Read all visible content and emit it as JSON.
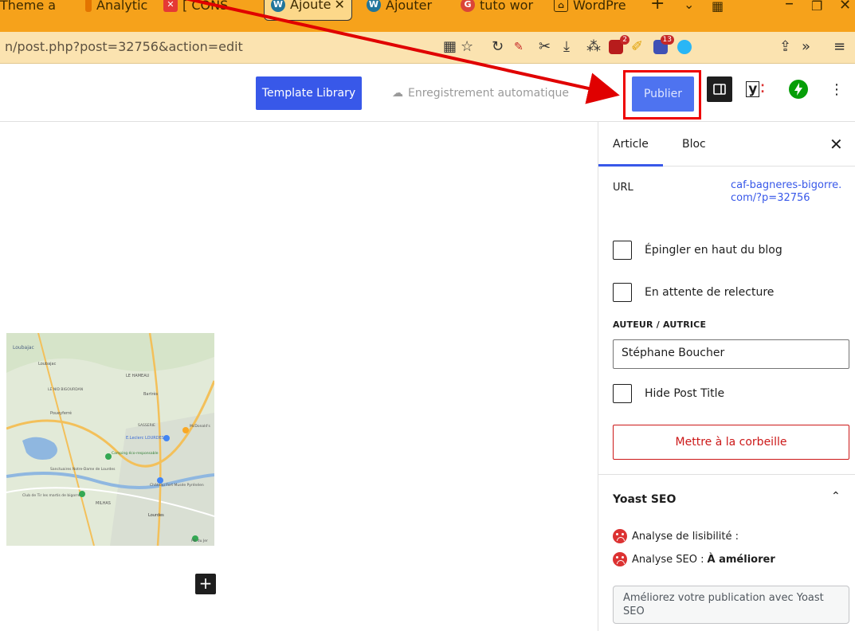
{
  "browser": {
    "tabs": [
      {
        "label": "Theme a",
        "icon": "theme-tab-icon"
      },
      {
        "label": "Analytic",
        "icon": "analytics-tab-icon"
      },
      {
        "label": "[ CONS",
        "icon": "cons-tab-icon"
      },
      {
        "label": "Ajoute",
        "icon": "wordpress-tab-icon"
      },
      {
        "label": "Ajouter",
        "icon": "wordpress-tab-icon"
      },
      {
        "label": "tuto wor",
        "icon": "google-tab-icon"
      },
      {
        "label": "WordPre",
        "icon": "wordpress-tab-icon"
      }
    ],
    "url": "n/post.php?post=32756&action=edit",
    "extension_badges": {
      "badge_a": "2",
      "badge_b": "13"
    }
  },
  "header": {
    "template_button": "Template Library",
    "autosave_label": "Enregistrement automatique",
    "publish_button": "Publier"
  },
  "sidebar": {
    "tabs": [
      "Article",
      "Bloc"
    ],
    "url_label": "URL",
    "url_value": "caf-bagneres-bigorre.com/?p=32756",
    "checkbox_pin": "Épingler en haut du blog",
    "checkbox_review": "En attente de relecture",
    "author_label": "AUTEUR / AUTRICE",
    "author_value": "Stéphane Boucher",
    "checkbox_hide_title": "Hide Post Title",
    "trash_button": "Mettre à la corbeille",
    "yoast_title": "Yoast SEO",
    "readability_label": "Analyse de lisibilité :",
    "seo_label": "Analyse SEO :",
    "seo_value": "À améliorer",
    "yoast_button": "Améliorez votre publication avec Yoast SEO"
  },
  "map_labels": [
    "Loubajac",
    "LE HAMEAU",
    "LE NID BIGOURDAN",
    "Bartrès",
    "Poueyferré",
    "SASSERIE",
    "E.Leclerc LOURDES",
    "Camping éco-responsable",
    "Sanctuaires Notre-Dame de Lourdes",
    "Château Fort Musée Pyrénéen",
    "Club de Tir les martis de bigorre",
    "MILHAS",
    "Lourdes",
    "Pic du Jer",
    "McDonald's"
  ],
  "colors": {
    "accent": "#3858e9",
    "danger": "#cc1818",
    "annotation": "#e00000",
    "browser": "#f6a21b"
  }
}
